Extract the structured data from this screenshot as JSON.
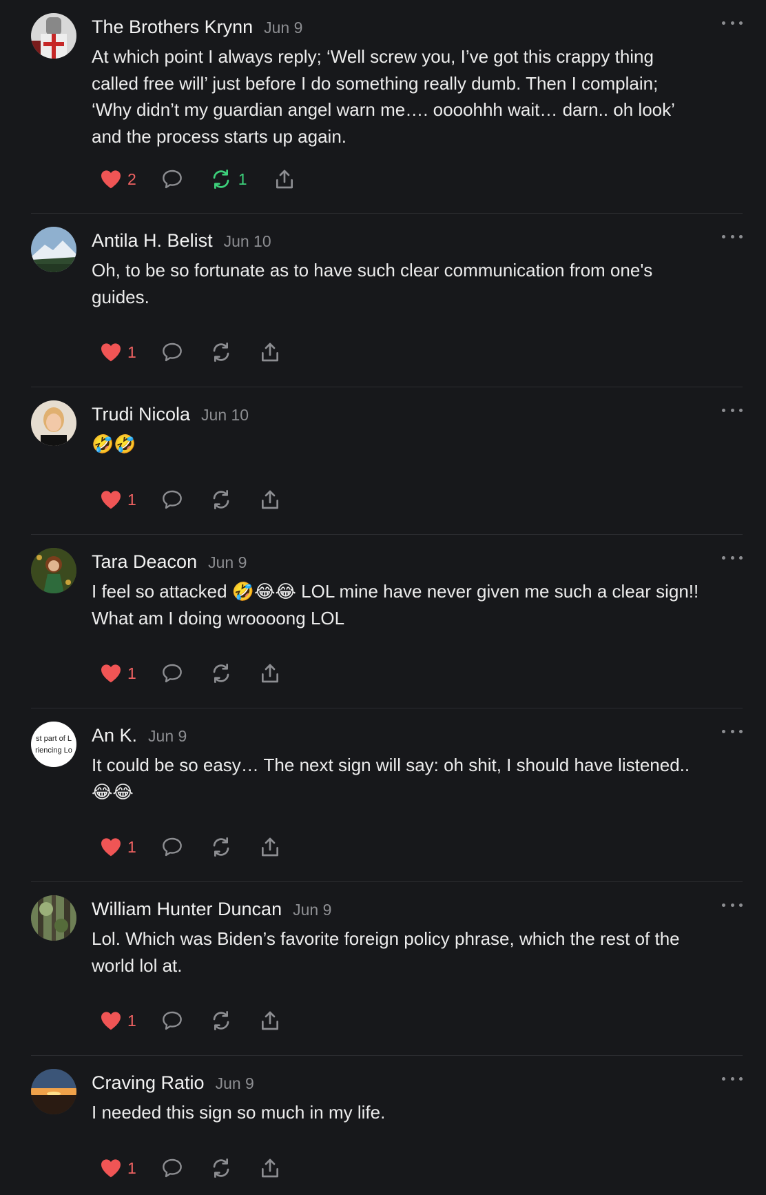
{
  "colors": {
    "background": "#17181b",
    "heart": "#f05555",
    "restack_active": "#3dd17b",
    "icon_muted": "#8d8e92"
  },
  "comments": [
    {
      "author": "The Brothers Krynn",
      "date": "Jun 9",
      "text_lines": [
        "At which point I always reply; ‘Well screw you, I’ve got this crappy thing",
        "called free will’ just before I do something really dumb. Then I complain;",
        "‘Why didn’t my guardian angel warn me…. oooohhh wait… darn.. oh look’",
        "and the process starts up again."
      ],
      "likes": "2",
      "restacks": "1",
      "avatar": "knight-avatar"
    },
    {
      "author": "Antila H. Belist",
      "date": "Jun 10",
      "text_lines": [
        "Oh, to be so fortunate as to have such clear communication from one's",
        "guides."
      ],
      "likes": "1",
      "restacks": "",
      "avatar": "mountain-avatar"
    },
    {
      "author": "Trudi Nicola",
      "date": "Jun 10",
      "text_lines": [
        "🤣🤣"
      ],
      "likes": "1",
      "restacks": "",
      "avatar": "portrait-avatar"
    },
    {
      "author": "Tara Deacon",
      "date": "Jun 9",
      "text_lines": [
        "I feel so attacked 🤣😂😂 LOL mine have never given me such a clear sign!!",
        "What am I doing wroooong LOL"
      ],
      "likes": "1",
      "restacks": "",
      "avatar": "painting-avatar"
    },
    {
      "author": "An K.",
      "date": "Jun 9",
      "text_lines": [
        "It could be so easy… The next sign will say: oh shit, I should have listened..",
        "😂😂"
      ],
      "likes": "1",
      "restacks": "",
      "avatar": "text-avatar",
      "avatar_text": [
        "st part of L",
        "riencing Lo"
      ]
    },
    {
      "author": "William Hunter Duncan",
      "date": "Jun 9",
      "text_lines": [
        "Lol. Which was Biden’s favorite foreign policy phrase, which the rest of the",
        "world lol at."
      ],
      "likes": "1",
      "restacks": "",
      "avatar": "forest-avatar"
    },
    {
      "author": "Craving Ratio",
      "date": "Jun 9",
      "text_lines": [
        "I needed this sign so much in my life."
      ],
      "likes": "1",
      "restacks": "",
      "avatar": "sunset-avatar"
    }
  ]
}
